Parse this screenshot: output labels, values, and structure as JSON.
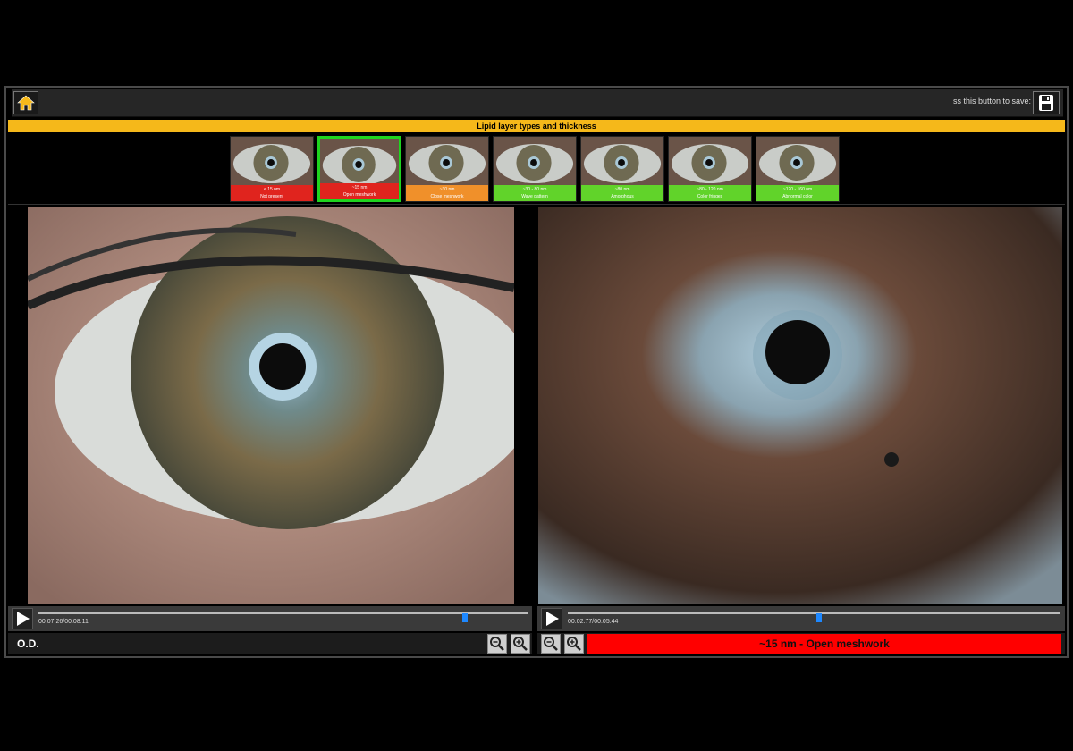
{
  "toolbar": {
    "save_hint": "ss this button to save:"
  },
  "banner": {
    "title": "Lipid layer types and thickness"
  },
  "thumbnails": [
    {
      "range": "< 15 nm",
      "name": "Not present",
      "color": "#e0241e"
    },
    {
      "range": "~15 nm",
      "name": "Open meshwork",
      "color": "#e0241e"
    },
    {
      "range": "~30 nm",
      "name": "Close meshwork",
      "color": "#f0902a"
    },
    {
      "range": "~30 - 80 nm",
      "name": "Wave pattern",
      "color": "#61d32a"
    },
    {
      "range": "~80 nm",
      "name": "Amorphous",
      "color": "#61d32a"
    },
    {
      "range": "~80 - 120 nm",
      "name": "Color fringes",
      "color": "#61d32a"
    },
    {
      "range": "~120 - 160 nm",
      "name": "Abnormal color",
      "color": "#61d32a"
    }
  ],
  "selected_thumbnail_index": 1,
  "left_player": {
    "timecode": "00:07.26/00:08.11",
    "progress": 0.87
  },
  "right_player": {
    "timecode": "00:02.77/00:05.44",
    "progress": 0.51
  },
  "eye": {
    "label": "O.D."
  },
  "status": {
    "text": "~15 nm - Open meshwork",
    "color": "#ff0000"
  },
  "icons": {
    "home": "home-icon",
    "save": "floppy-disk-icon",
    "zoom_in": "zoom-in-icon",
    "zoom_out": "zoom-out-icon",
    "play": "play-icon"
  }
}
